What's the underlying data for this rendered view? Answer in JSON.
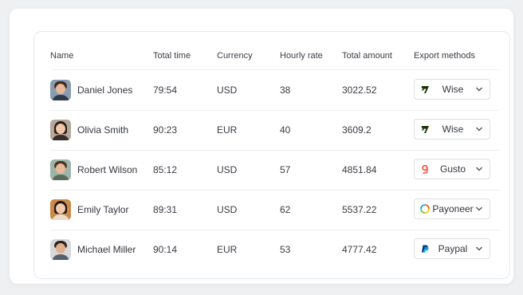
{
  "table": {
    "headers": {
      "name": "Name",
      "total_time": "Total time",
      "currency": "Currency",
      "hourly_rate": "Hourly rate",
      "total_amount": "Total amount",
      "export_methods": "Export methods"
    },
    "rows": [
      {
        "name": "Daniel Jones",
        "time": "79:54",
        "currency": "USD",
        "rate": "38",
        "amount": "3022.52",
        "export": "Wise",
        "export_icon": "wise-icon"
      },
      {
        "name": "Olivia Smith",
        "time": "90:23",
        "currency": "EUR",
        "rate": "40",
        "amount": "3609.2",
        "export": "Wise",
        "export_icon": "wise-icon"
      },
      {
        "name": "Robert Wilson",
        "time": "85:12",
        "currency": "USD",
        "rate": "57",
        "amount": "4851.84",
        "export": "Gusto",
        "export_icon": "gusto-icon"
      },
      {
        "name": "Emily Taylor",
        "time": "89:31",
        "currency": "USD",
        "rate": "62",
        "amount": "5537.22",
        "export": "Payoneer",
        "export_icon": "payoneer-icon"
      },
      {
        "name": "Michael Miller",
        "time": "90:14",
        "currency": "EUR",
        "rate": "53",
        "amount": "4777.42",
        "export": "Paypal",
        "export_icon": "paypal-icon"
      }
    ]
  },
  "colors": {
    "wise": "#163300",
    "gusto": "#f45d48",
    "paypal": "#003087",
    "payoneer_ring": [
      "#ff4800",
      "#ffc300",
      "#00a0e3",
      "#6cbd45"
    ]
  }
}
